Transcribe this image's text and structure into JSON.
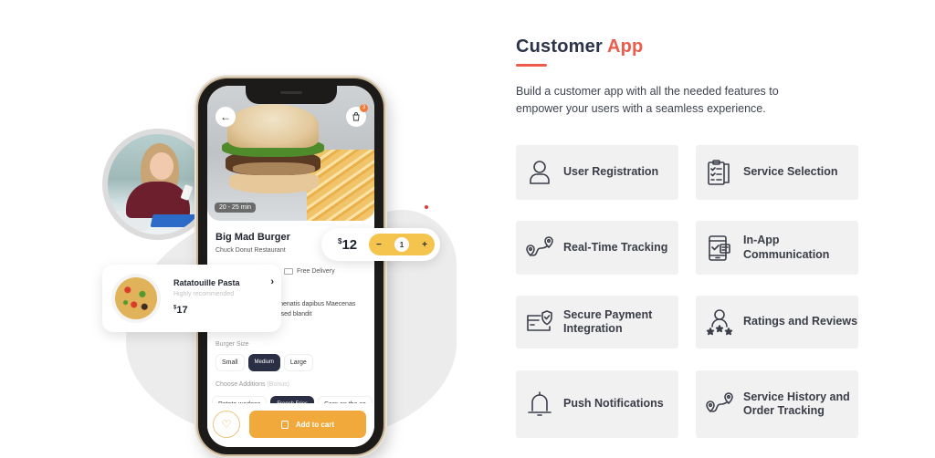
{
  "header": {
    "title_main": "Customer",
    "title_accent": "App",
    "accent_color": "#ec5b4c",
    "description": "Build a customer app with all the needed features to empower your users with a seamless experience."
  },
  "features": [
    {
      "label": "User Registration",
      "icon": "user-icon"
    },
    {
      "label": "Service Selection",
      "icon": "checklist-clipboard-icon"
    },
    {
      "label": "Real-Time Tracking",
      "icon": "route-pins-icon"
    },
    {
      "label": "In-App Communication",
      "icon": "phone-chat-icon"
    },
    {
      "label": "Secure Payment Integration",
      "icon": "card-shield-icon"
    },
    {
      "label": "Ratings and Reviews",
      "icon": "user-stars-icon"
    },
    {
      "label": "Push Notifications",
      "icon": "bell-icon"
    },
    {
      "label": "Service History and Order Tracking",
      "icon": "route-pins-icon"
    }
  ],
  "phone": {
    "delivery_time": "20 - 25 min",
    "cart_badge": "3",
    "food_title": "Big Mad Burger",
    "restaurant": "Chuck Donut Restaurant",
    "free_delivery": "Free Delivery",
    "description": "nte venenatis dapibus Maecenas varius sed blandit",
    "size_label": "Burger Size",
    "sizes": [
      "Small",
      "Medium",
      "Large"
    ],
    "selected_size": "Medium",
    "additions_label": "Choose Additions",
    "additions_hint": "(Bonus)",
    "additions": [
      "Potato wedges",
      "French Fries",
      "Corn on the co"
    ],
    "selected_addition": "French Fries",
    "add_to_cart": "Add to cart",
    "back_glyph": "←",
    "heart_glyph": "♡"
  },
  "price_pill": {
    "currency": "$",
    "amount": "12",
    "quantity": "1",
    "minus": "−",
    "plus": "+"
  },
  "pasta_card": {
    "name": "Ratatouille Pasta",
    "subtitle": "Highly recommended",
    "currency": "$",
    "price": "17",
    "arrow": "›"
  }
}
